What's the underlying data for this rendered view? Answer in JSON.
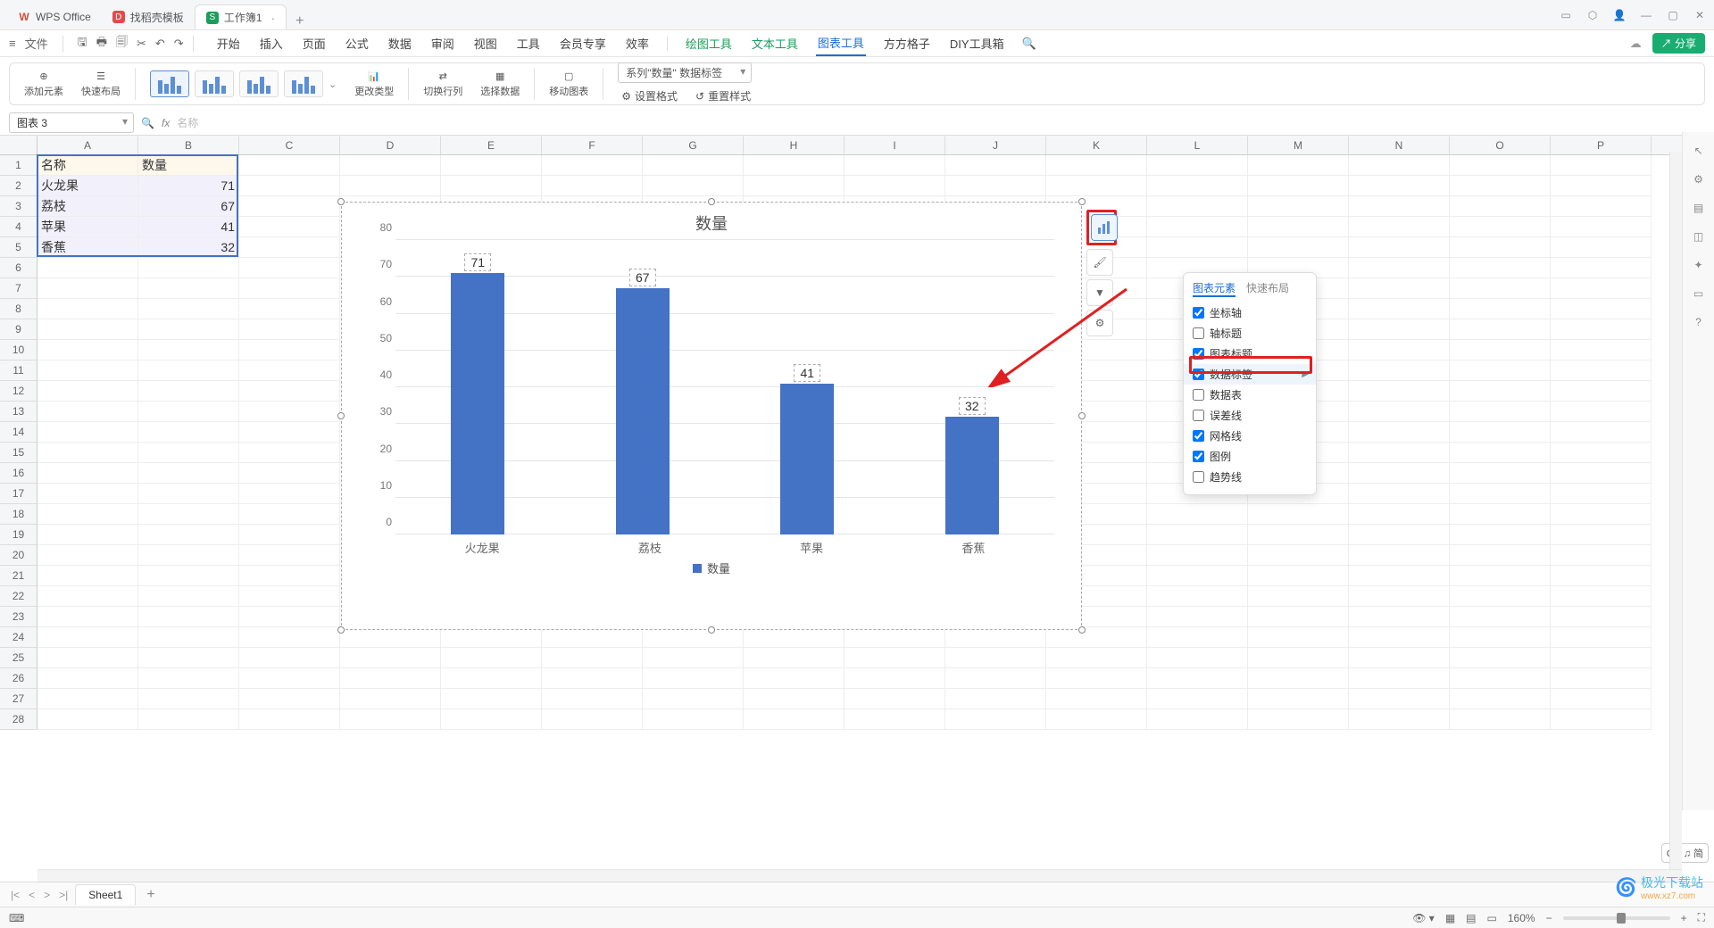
{
  "app": {
    "name": "WPS Office"
  },
  "tabs": [
    {
      "label": "WPS Office",
      "icon": "W"
    },
    {
      "label": "找稻壳模板",
      "icon": "D"
    },
    {
      "label": "工作簿1",
      "icon": "S",
      "active": true
    }
  ],
  "menu": {
    "file": "文件",
    "items": [
      "开始",
      "插入",
      "页面",
      "公式",
      "数据",
      "审阅",
      "视图",
      "工具",
      "会员专享",
      "效率"
    ],
    "context": [
      "绘图工具",
      "文本工具",
      "图表工具",
      "方方格子",
      "DIY工具箱"
    ],
    "active_context": "图表工具",
    "share": "分享"
  },
  "ribbon": {
    "add_element": "添加元素",
    "quick_layout": "快速布局",
    "change_type": "更改类型",
    "switch_rc": "切换行列",
    "select_data": "选择数据",
    "move_chart": "移动图表",
    "series_dd": "系列\"数量\" 数据标签",
    "set_format": "设置格式",
    "reset_style": "重置样式"
  },
  "name_box": "图表 3",
  "formula_hint": "名称",
  "columns": [
    "A",
    "B",
    "C",
    "D",
    "E",
    "F",
    "G",
    "H",
    "I",
    "J",
    "K",
    "L",
    "M",
    "N",
    "O",
    "P"
  ],
  "cells": {
    "A1": "名称",
    "B1": "数量",
    "A2": "火龙果",
    "B2": "71",
    "A3": "荔枝",
    "B3": "67",
    "A4": "苹果",
    "B4": "41",
    "A5": "香蕉",
    "B5": "32"
  },
  "chart_data": {
    "type": "bar",
    "title": "数量",
    "categories": [
      "火龙果",
      "荔枝",
      "苹果",
      "香蕉"
    ],
    "values": [
      71,
      67,
      41,
      32
    ],
    "series_name": "数量",
    "ylim": [
      0,
      80
    ],
    "y_ticks": [
      0,
      10,
      20,
      30,
      40,
      50,
      60,
      70,
      80
    ],
    "xlabel": "",
    "ylabel": "",
    "legend": "数量"
  },
  "popup": {
    "tab_elements": "图表元素",
    "tab_layout": "快速布局",
    "items": [
      {
        "label": "坐标轴",
        "checked": true
      },
      {
        "label": "轴标题",
        "checked": false
      },
      {
        "label": "图表标题",
        "checked": true
      },
      {
        "label": "数据标签",
        "checked": true,
        "highlight": true,
        "arrow": true
      },
      {
        "label": "数据表",
        "checked": false
      },
      {
        "label": "误差线",
        "checked": false
      },
      {
        "label": "网格线",
        "checked": true
      },
      {
        "label": "图例",
        "checked": true
      },
      {
        "label": "趋势线",
        "checked": false
      }
    ]
  },
  "sheet": {
    "name": "Sheet1"
  },
  "status": {
    "zoom": "160%",
    "ime": "CH ♫ 简"
  },
  "watermark": {
    "brand": "极光下载站",
    "url": "www.xz7.com"
  }
}
